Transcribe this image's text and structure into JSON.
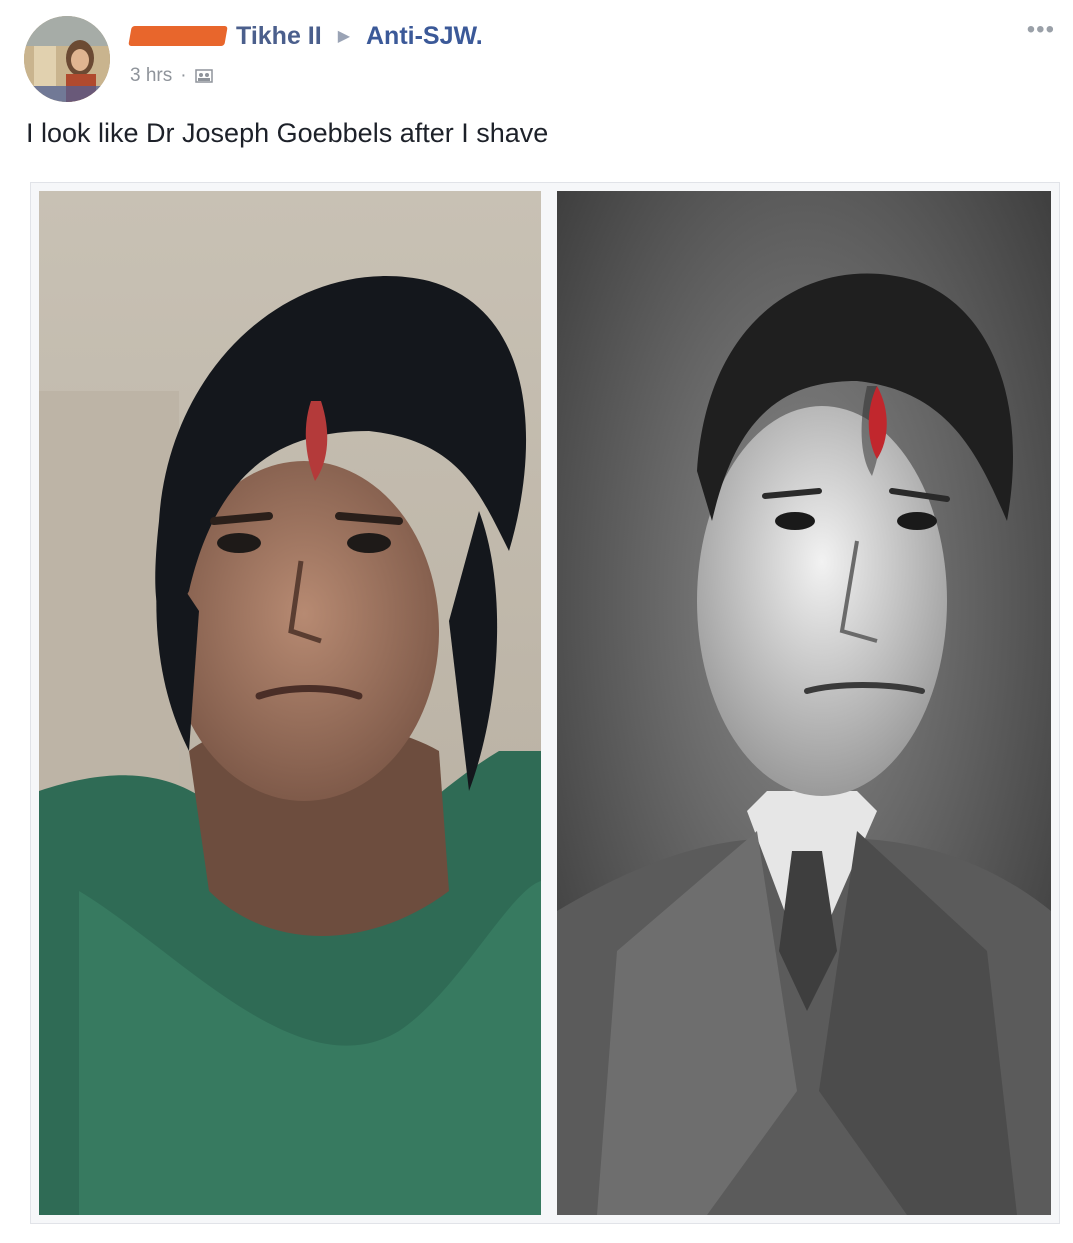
{
  "post": {
    "author": "Tikhe II",
    "group": "Anti-SJW.",
    "timestamp": "3 hrs",
    "privacy_icon": "group-privacy-icon",
    "more_label": "•••",
    "text": "I look like Dr Joseph Goebbels after I shave"
  },
  "colors": {
    "link": "#3b5998",
    "redaction": "#e8662c",
    "meta": "#8f949b"
  }
}
